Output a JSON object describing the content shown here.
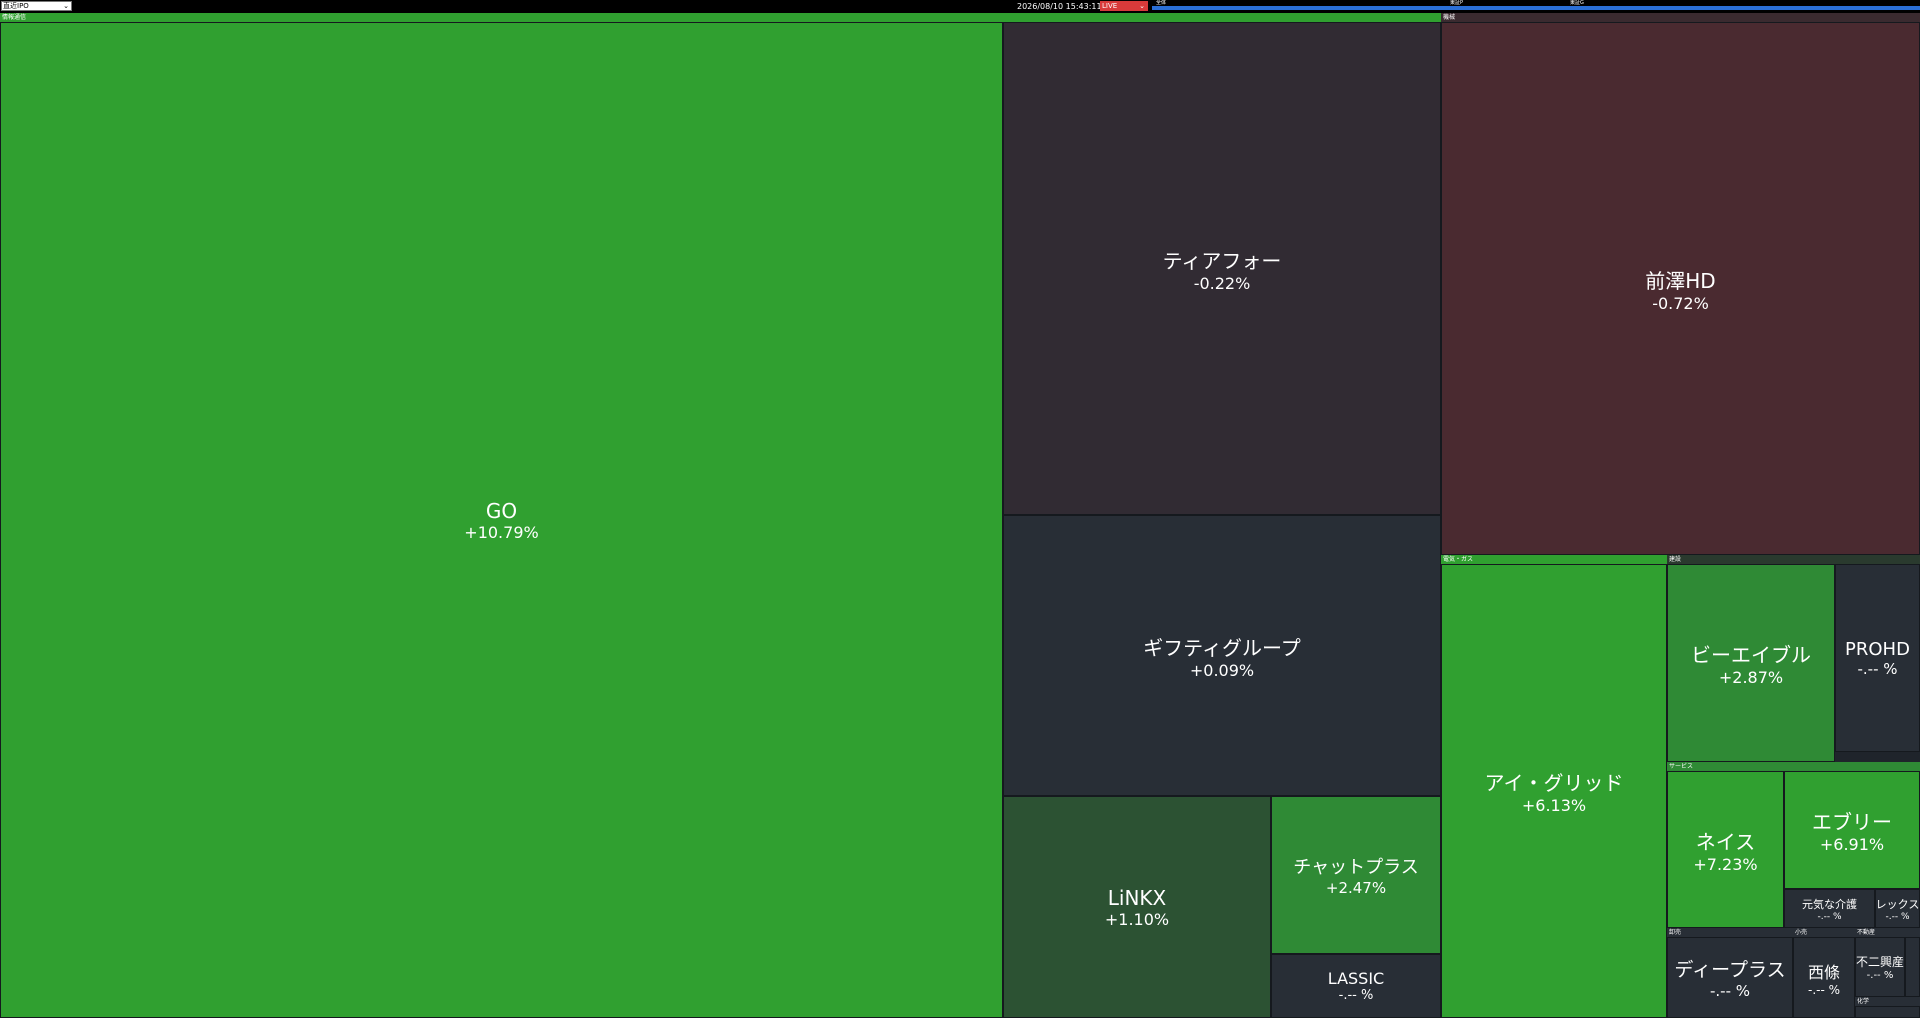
{
  "header": {
    "select_value": "直近IPO",
    "datetime": "2026/08/10 15:43:11",
    "live_value": "LIVE",
    "slider_labels": [
      "全体",
      "東証P",
      "東証G"
    ],
    "accent_color": "#2a6fd6",
    "live_color": "#d83a3a"
  },
  "sectors": {
    "info": "情報通信",
    "machine": "機械",
    "electric": "電気・ガス",
    "construction": "建設",
    "service": "サービス",
    "wholesale": "卸売",
    "retail": "小売",
    "realestate": "不動産",
    "chemical": "化学"
  },
  "stocks": {
    "go": {
      "name": "GO",
      "pct": "+10.79%"
    },
    "tierfour": {
      "name": "ティアフォー",
      "pct": "-0.22%"
    },
    "giftee": {
      "name": "ギフティグループ",
      "pct": "+0.09%"
    },
    "linkx": {
      "name": "LiNKX",
      "pct": "+1.10%"
    },
    "chatplus": {
      "name": "チャットプラス",
      "pct": "+2.47%"
    },
    "lassic": {
      "name": "LASSIC",
      "pct": "-.-- %"
    },
    "maezawa": {
      "name": "前澤HD",
      "pct": "-0.72%"
    },
    "igrid": {
      "name": "アイ・グリッド",
      "pct": "+6.13%"
    },
    "beable": {
      "name": "ビーエイブル",
      "pct": "+2.87%"
    },
    "prohd": {
      "name": "PROHD",
      "pct": "-.-- %"
    },
    "neis": {
      "name": "ネイス",
      "pct": "+7.23%"
    },
    "every": {
      "name": "エブリー",
      "pct": "+6.91%"
    },
    "genki": {
      "name": "元気な介護",
      "pct": "-.-- %"
    },
    "lex": {
      "name": "レックス",
      "pct": "-.-- %"
    },
    "deeplus": {
      "name": "ディープラス",
      "pct": "-.-- %"
    },
    "saijo": {
      "name": "西條",
      "pct": "-.-- %"
    },
    "fujiko": {
      "name": "不二興産",
      "pct": "-.-- %"
    },
    "tiny": {
      "name": "",
      "pct": ""
    }
  }
}
